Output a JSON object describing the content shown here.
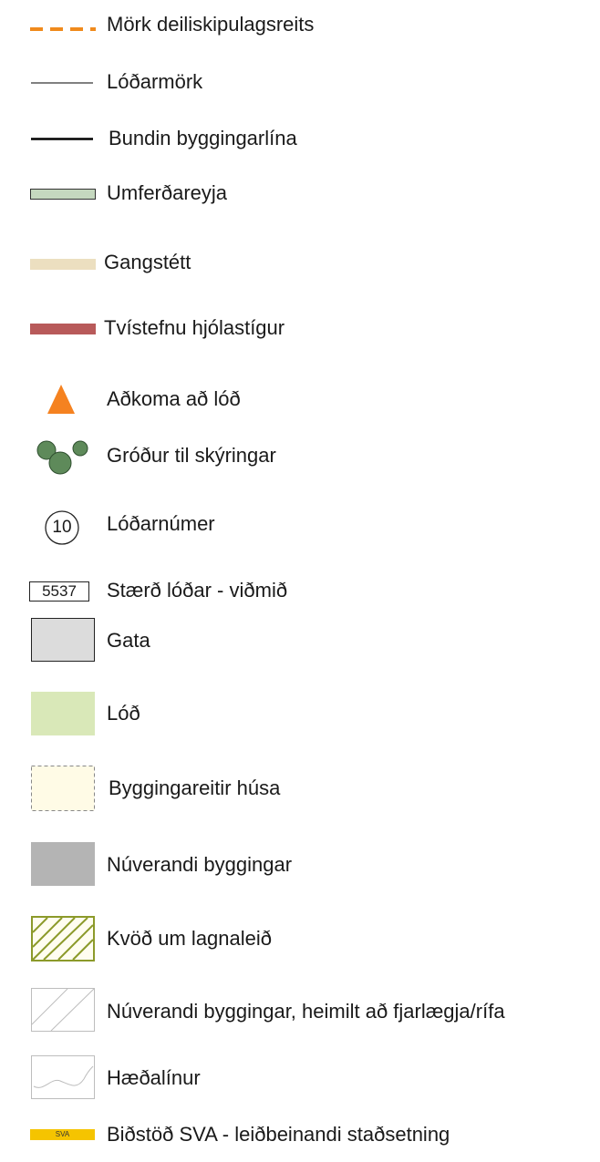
{
  "legend": {
    "items": [
      {
        "key": "mork-deiliskipulagsreits",
        "label": "Mörk deiliskipulagsreits",
        "symbol": "dashed-line",
        "color": "#f08a1c"
      },
      {
        "key": "lodarmork",
        "label": "Lóðarmörk",
        "symbol": "thin-line",
        "color": "#000000"
      },
      {
        "key": "bundin-byggingarlina",
        "label": "Bundin byggingarlína",
        "symbol": "thick-line",
        "color": "#000000"
      },
      {
        "key": "umferdareyja",
        "label": "Umferðareyja",
        "symbol": "filled-bar",
        "color": "#c5d8bf"
      },
      {
        "key": "gangstett",
        "label": "Gangstétt",
        "symbol": "filled-bar",
        "color": "#ecdfc0"
      },
      {
        "key": "tvistefnu-hjolastigur",
        "label": "Tvístefnu hjólastígur",
        "symbol": "filled-bar",
        "color": "#b85a5a"
      },
      {
        "key": "adkoma-ad-lod",
        "label": "Aðkoma að lóð",
        "symbol": "triangle",
        "color": "#f58220"
      },
      {
        "key": "grodur-til-skyringar",
        "label": "Gróður til skýringar",
        "symbol": "trees",
        "color": "#5e8a5a"
      },
      {
        "key": "lodarnumer",
        "label": "Lóðarnúmer",
        "symbol": "circle-number",
        "symbol_text": "10"
      },
      {
        "key": "staerd-lodar",
        "label": "Stærð lóðar - viðmið",
        "symbol": "boxed-number",
        "symbol_text": "5537"
      },
      {
        "key": "gata",
        "label": "Gata",
        "symbol": "swatch",
        "color": "#dcdcdc"
      },
      {
        "key": "lod",
        "label": "Lóð",
        "symbol": "swatch",
        "color": "#d9e8b8"
      },
      {
        "key": "byggingareitir-husa",
        "label": "Byggingareitir húsa",
        "symbol": "dashed-swatch",
        "color": "#fffbe6"
      },
      {
        "key": "nuverandi-byggingar",
        "label": "Núverandi byggingar",
        "symbol": "swatch",
        "color": "#b4b4b4"
      },
      {
        "key": "kvod-um-lagnaleid",
        "label": "Kvöð um lagnaleið",
        "symbol": "hatched-swatch",
        "color": "#8c9a2a"
      },
      {
        "key": "nuverandi-byggingar-rifa",
        "label": "Núverandi byggingar, heimilt að  fjarlægja/rífa",
        "symbol": "hatched-swatch",
        "color": "#bdbdbd"
      },
      {
        "key": "haedalinur",
        "label": "Hæðalínur",
        "symbol": "contour-swatch",
        "color": "#bdbdbd"
      },
      {
        "key": "bidstod-sva",
        "label": "Biðstöð SVA - leiðbeinandi staðsetning",
        "symbol": "badge",
        "symbol_text": "SVA",
        "color": "#f5c400"
      }
    ]
  }
}
